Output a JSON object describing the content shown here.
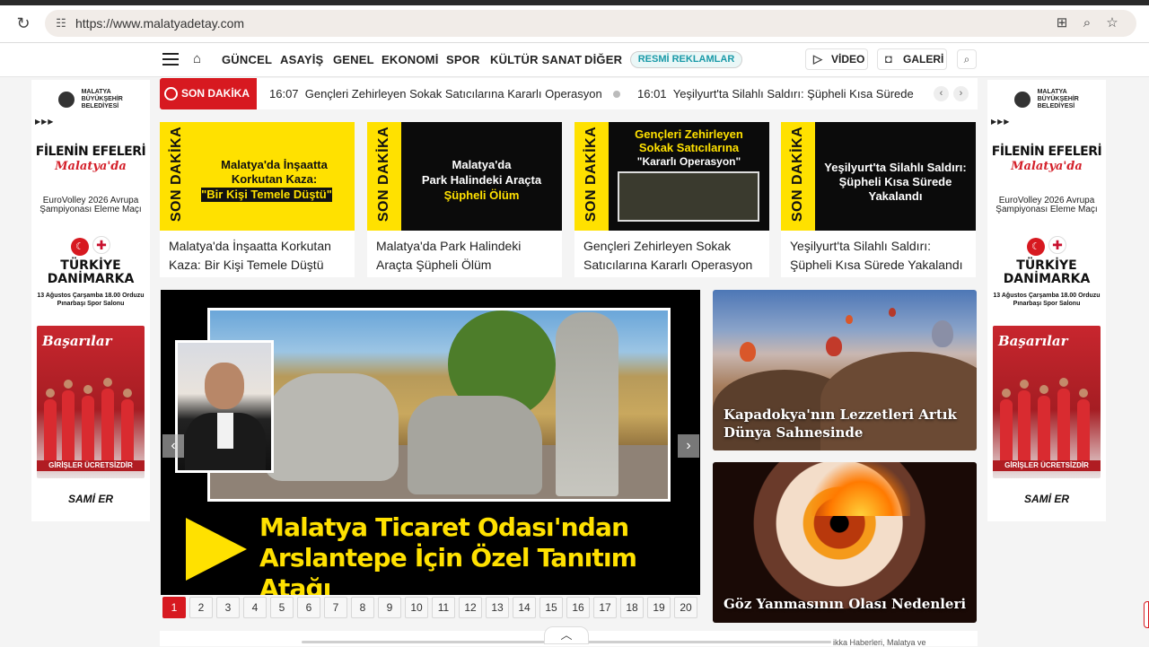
{
  "browser": {
    "url": "https://www.malatyadetay.com"
  },
  "nav": {
    "items": [
      "GÜNCEL",
      "ASAYİŞ",
      "GENEL",
      "EKONOMİ",
      "SPOR",
      "KÜLTÜR SANAT",
      "DİĞER"
    ],
    "resmi": "RESMİ REKLAMLAR",
    "video": "VİDEO",
    "galeri": "GALERİ"
  },
  "ad": {
    "logo_line1": "MALATYA",
    "logo_line2": "BÜYÜKŞEHİR",
    "logo_line3": "BELEDİYESİ",
    "arrows": "▶▶▶",
    "title1": "FİLENİN EFELERİ",
    "title2": "Malatya'da",
    "event": "EuroVolley 2026 Avrupa Şampiyonası Eleme Maçı",
    "team1": "TÜRKİYE",
    "team2": "DANİMARKA",
    "date": "13 Ağustos Çarşamba 18.00 Orduzu Pınarbaşı Spor Salonu",
    "photo_text": "Başarılar",
    "free": "GİRİŞLER ÜCRETSİZDİR",
    "sponsor": "SAMİ ER"
  },
  "ticker": {
    "badge": "SON DAKİKA",
    "items": [
      {
        "time": "16:07",
        "text": "Gençleri Zehirleyen Sokak Satıcılarına Kararlı Operasyon"
      },
      {
        "time": "16:01",
        "text": "Yeşilyurt'ta Silahlı Saldırı: Şüpheli Kısa Sürede Y"
      }
    ]
  },
  "cards": [
    {
      "side": "SON DAKİKA",
      "line1": "Malatya'da İnşaatta",
      "line2": "Korkutan Kaza:",
      "line3": "\"Bir Kişi Temele Düştü\"",
      "caption": "Malatya'da İnşaatta Korkutan Kaza: Bir Kişi Temele Düştü"
    },
    {
      "side": "SON DAKİKA",
      "line1": "Malatya'da",
      "line2": "Park Halindeki Araçta",
      "line3": "Şüpheli Ölüm",
      "caption": "Malatya'da Park Halindeki Araçta Şüpheli Ölüm"
    },
    {
      "side": "SON DAKİKA",
      "line1": "Gençleri Zehirleyen",
      "line2": "Sokak Satıcılarına",
      "line3": "\"Kararlı Operasyon\"",
      "caption": "Gençleri Zehirleyen Sokak Satıcılarına Kararlı Operasyon"
    },
    {
      "side": "SON DAKİKA",
      "line1": "Yeşilyurt'ta Silahlı Saldırı:",
      "line2": "Şüpheli Kısa Sürede",
      "line3": "Yakalandı",
      "caption": "Yeşilyurt'ta Silahlı Saldırı: Şüpheli Kısa Sürede Yakalandı"
    }
  ],
  "hero": {
    "title_line1": "Malatya Ticaret Odası'ndan",
    "title_line2": "Arslantepe İçin Özel Tanıtım Atağı"
  },
  "pager": [
    "1",
    "2",
    "3",
    "4",
    "5",
    "6",
    "7",
    "8",
    "9",
    "10",
    "11",
    "12",
    "13",
    "14",
    "15",
    "16",
    "17",
    "18",
    "19",
    "20"
  ],
  "tiles": {
    "capp": "Kapadokya'nın Lezzetleri Artık Dünya Sahnesinde",
    "eye": "Göz Yanmasının Olası Nedenleri"
  },
  "bottom_text": "ikka Haberleri, Malatya ve",
  "colors": {
    "accent_red": "#d71920",
    "accent_yellow": "#ffe100"
  }
}
